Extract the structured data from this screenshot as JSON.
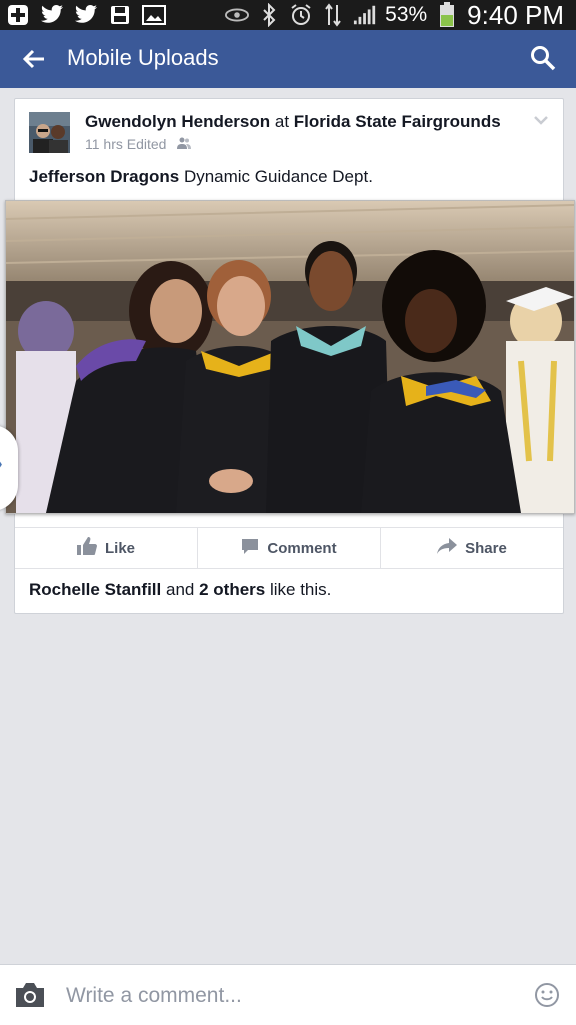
{
  "status_bar": {
    "battery": "53%",
    "time": "9:40 PM",
    "icons": [
      "plus-icon",
      "twitter-icon",
      "twitter-icon",
      "save-icon",
      "gallery-icon",
      "eye-icon",
      "bluetooth-icon",
      "alarm-icon",
      "network-icon",
      "signal-icon",
      "battery-icon"
    ]
  },
  "app_bar": {
    "title": "Mobile Uploads",
    "back_icon": "arrow-left-icon",
    "search_icon": "search-icon"
  },
  "post": {
    "author": "Gwendolyn Henderson",
    "at_word": "at",
    "location": "Florida State Fairgrounds",
    "time": "11 hrs",
    "edited": "Edited",
    "caption_tag": "Jefferson Dragons",
    "caption_text": "Dynamic Guidance Dept.",
    "actions": {
      "like": "Like",
      "comment": "Comment",
      "share": "Share"
    },
    "likes": {
      "name": "Rochelle Stanfill",
      "and": "and",
      "others": "2 others",
      "suffix": "like this."
    }
  },
  "composer": {
    "placeholder": "Write a comment..."
  },
  "colors": {
    "brand_blue": "#3b5998",
    "status_bar": "#1b1b1b",
    "battery_green": "#8bc34a"
  }
}
